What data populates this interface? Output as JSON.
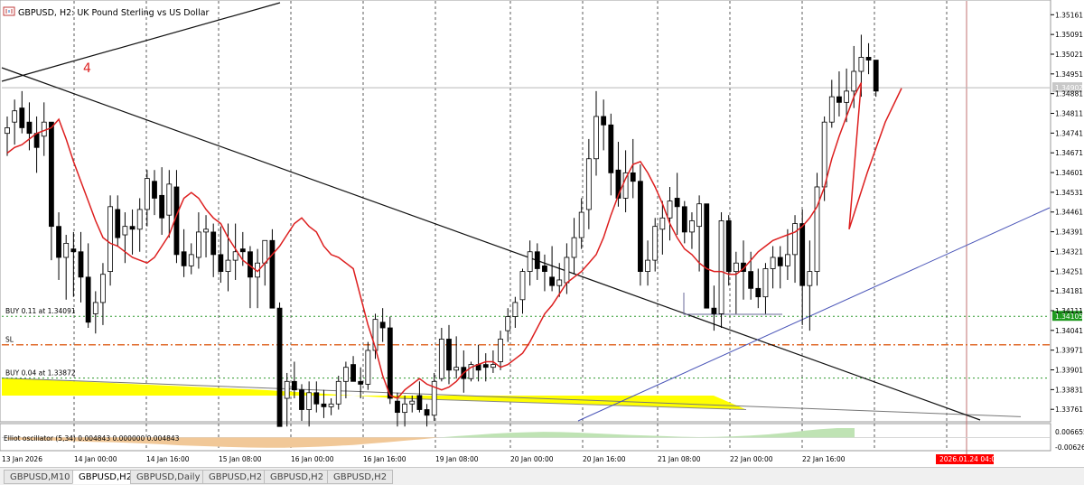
{
  "chart_data": {
    "type": "candlestick",
    "symbol_title": "GBPUSD, H2:  UK Pound Sterling vs US Dollar",
    "price_axis_labels": [
      "1.35161",
      "1.35091",
      "1.35021",
      "1.34951",
      "1.34881",
      "1.34811",
      "1.34741",
      "1.34671",
      "1.34601",
      "1.34531",
      "1.34461",
      "1.34391",
      "1.34321",
      "1.34251",
      "1.34181",
      "1.34111",
      "1.34041",
      "1.33971",
      "1.33901",
      "1.33831",
      "1.33761"
    ],
    "current_price_label": "1.34902",
    "time_axis_labels": [
      "13 Jan 2026",
      "14 Jan 00:00",
      "14 Jan 16:00",
      "15 Jan 08:00",
      "16 Jan 00:00",
      "16 Jan 16:00",
      "19 Jan 08:00",
      "20 Jan 00:00",
      "20 Jan 16:00",
      "21 Jan 08:00",
      "22 Jan 00:00",
      "22 Jan 16:00"
    ],
    "future_time_label": "2026.01.24 04:00",
    "ylim": [
      1.3372,
      1.3521
    ],
    "candles_ohlc": [
      [
        1.3474,
        1.348,
        1.3466,
        1.3476
      ],
      [
        1.3478,
        1.3486,
        1.347,
        1.3482
      ],
      [
        1.3483,
        1.3489,
        1.3474,
        1.3476
      ],
      [
        1.3478,
        1.3485,
        1.3468,
        1.3474
      ],
      [
        1.3474,
        1.348,
        1.346,
        1.3469
      ],
      [
        1.3473,
        1.3485,
        1.3466,
        1.3478
      ],
      [
        1.3478,
        1.3478,
        1.3429,
        1.3441
      ],
      [
        1.3441,
        1.3446,
        1.3422,
        1.343
      ],
      [
        1.343,
        1.3438,
        1.3415,
        1.3435
      ],
      [
        1.3433,
        1.3439,
        1.3416,
        1.3432
      ],
      [
        1.3432,
        1.3439,
        1.3414,
        1.3423
      ],
      [
        1.3423,
        1.3435,
        1.3405,
        1.3407
      ],
      [
        1.341,
        1.3418,
        1.3403,
        1.3414
      ],
      [
        1.3414,
        1.3428,
        1.3406,
        1.3424
      ],
      [
        1.3425,
        1.3452,
        1.342,
        1.3448
      ],
      [
        1.3447,
        1.3452,
        1.3434,
        1.3437
      ],
      [
        1.3438,
        1.3446,
        1.3428,
        1.3441
      ],
      [
        1.3441,
        1.3447,
        1.3431,
        1.344
      ],
      [
        1.344,
        1.3451,
        1.3432,
        1.3447
      ],
      [
        1.3447,
        1.3461,
        1.3441,
        1.3458
      ],
      [
        1.3457,
        1.3461,
        1.3445,
        1.3451
      ],
      [
        1.3452,
        1.3462,
        1.3438,
        1.3444
      ],
      [
        1.3445,
        1.3461,
        1.3437,
        1.3456
      ],
      [
        1.3455,
        1.3461,
        1.3428,
        1.3431
      ],
      [
        1.3432,
        1.344,
        1.3423,
        1.3427
      ],
      [
        1.3427,
        1.3435,
        1.3424,
        1.3431
      ],
      [
        1.343,
        1.3446,
        1.3426,
        1.3439
      ],
      [
        1.3439,
        1.3445,
        1.343,
        1.344
      ],
      [
        1.3439,
        1.3442,
        1.3423,
        1.3431
      ],
      [
        1.3431,
        1.3441,
        1.3421,
        1.3425
      ],
      [
        1.3425,
        1.3442,
        1.3418,
        1.3429
      ],
      [
        1.3429,
        1.3442,
        1.3422,
        1.3432
      ],
      [
        1.3433,
        1.3439,
        1.3427,
        1.3432
      ],
      [
        1.3432,
        1.3434,
        1.3412,
        1.3423
      ],
      [
        1.3423,
        1.3433,
        1.3412,
        1.3428
      ],
      [
        1.3428,
        1.3436,
        1.342,
        1.3436
      ],
      [
        1.3436,
        1.344,
        1.3418,
        1.3412
      ],
      [
        1.3412,
        1.3414,
        1.337,
        1.337
      ],
      [
        1.338,
        1.3389,
        1.337,
        1.3386
      ],
      [
        1.3386,
        1.3393,
        1.338,
        1.3383
      ],
      [
        1.3383,
        1.3385,
        1.3372,
        1.3376
      ],
      [
        1.3376,
        1.3386,
        1.337,
        1.3382
      ],
      [
        1.3382,
        1.3386,
        1.3375,
        1.3378
      ],
      [
        1.3378,
        1.3383,
        1.3373,
        1.3377
      ],
      [
        1.3377,
        1.338,
        1.3374,
        1.3378
      ],
      [
        1.3378,
        1.3388,
        1.3376,
        1.3386
      ],
      [
        1.3386,
        1.3393,
        1.338,
        1.3391
      ],
      [
        1.3392,
        1.3395,
        1.3386,
        1.3386
      ],
      [
        1.3386,
        1.3391,
        1.338,
        1.3385
      ],
      [
        1.3385,
        1.34,
        1.3383,
        1.3397
      ],
      [
        1.3397,
        1.341,
        1.3394,
        1.3408
      ],
      [
        1.3407,
        1.3412,
        1.34,
        1.3405
      ],
      [
        1.3405,
        1.3409,
        1.3378,
        1.338
      ],
      [
        1.3379,
        1.3382,
        1.337,
        1.3375
      ],
      [
        1.3375,
        1.3381,
        1.337,
        1.3378
      ],
      [
        1.3378,
        1.3381,
        1.3375,
        1.3379
      ],
      [
        1.3381,
        1.3386,
        1.3375,
        1.3376
      ],
      [
        1.3376,
        1.3378,
        1.337,
        1.3374
      ],
      [
        1.3374,
        1.3389,
        1.3372,
        1.3386
      ],
      [
        1.3387,
        1.3405,
        1.3386,
        1.3401
      ],
      [
        1.3401,
        1.3406,
        1.3385,
        1.339
      ],
      [
        1.339,
        1.3402,
        1.3387,
        1.3391
      ],
      [
        1.3391,
        1.3397,
        1.3382,
        1.3387
      ],
      [
        1.3387,
        1.3393,
        1.3386,
        1.3392
      ],
      [
        1.3392,
        1.3399,
        1.3386,
        1.339
      ],
      [
        1.3392,
        1.3396,
        1.3386,
        1.3391
      ],
      [
        1.3391,
        1.3397,
        1.3389,
        1.3392
      ],
      [
        1.3393,
        1.3404,
        1.339,
        1.3401
      ],
      [
        1.3404,
        1.3412,
        1.34,
        1.3409
      ],
      [
        1.3409,
        1.3416,
        1.3405,
        1.3414
      ],
      [
        1.3415,
        1.3426,
        1.341,
        1.3425
      ],
      [
        1.3425,
        1.3436,
        1.342,
        1.3432
      ],
      [
        1.3432,
        1.3435,
        1.3422,
        1.3426
      ],
      [
        1.3427,
        1.3431,
        1.3418,
        1.3425
      ],
      [
        1.3423,
        1.3434,
        1.3418,
        1.342
      ],
      [
        1.342,
        1.3428,
        1.3416,
        1.3422
      ],
      [
        1.3421,
        1.3435,
        1.3417,
        1.343
      ],
      [
        1.343,
        1.3444,
        1.3424,
        1.3437
      ],
      [
        1.3437,
        1.3451,
        1.3433,
        1.3446
      ],
      [
        1.3447,
        1.3472,
        1.344,
        1.3465
      ],
      [
        1.3465,
        1.3489,
        1.3459,
        1.348
      ],
      [
        1.348,
        1.3486,
        1.3468,
        1.3477
      ],
      [
        1.3477,
        1.3481,
        1.3452,
        1.346
      ],
      [
        1.3461,
        1.3471,
        1.3448,
        1.3451
      ],
      [
        1.3451,
        1.3468,
        1.3446,
        1.346
      ],
      [
        1.346,
        1.3472,
        1.3451,
        1.3457
      ],
      [
        1.3457,
        1.3463,
        1.342,
        1.3425
      ],
      [
        1.3425,
        1.3436,
        1.342,
        1.3429
      ],
      [
        1.3429,
        1.3444,
        1.3425,
        1.3441
      ],
      [
        1.344,
        1.345,
        1.3431,
        1.3444
      ],
      [
        1.3444,
        1.3455,
        1.3436,
        1.345
      ],
      [
        1.3451,
        1.346,
        1.3438,
        1.3448
      ],
      [
        1.3448,
        1.345,
        1.3435,
        1.3439
      ],
      [
        1.3439,
        1.3446,
        1.3433,
        1.3443
      ],
      [
        1.3441,
        1.3452,
        1.3425,
        1.3449
      ],
      [
        1.3449,
        1.3446,
        1.3412,
        1.3412
      ],
      [
        1.3412,
        1.342,
        1.3404,
        1.341
      ],
      [
        1.341,
        1.3446,
        1.3405,
        1.3443
      ],
      [
        1.3443,
        1.3445,
        1.342,
        1.3425
      ],
      [
        1.3425,
        1.3432,
        1.341,
        1.3428
      ],
      [
        1.3428,
        1.3436,
        1.3415,
        1.3425
      ],
      [
        1.3425,
        1.3432,
        1.3415,
        1.3419
      ],
      [
        1.3419,
        1.3426,
        1.3412,
        1.3416
      ],
      [
        1.3416,
        1.3428,
        1.341,
        1.3426
      ],
      [
        1.3426,
        1.3434,
        1.3419,
        1.343
      ],
      [
        1.343,
        1.3434,
        1.3419,
        1.3427
      ],
      [
        1.3427,
        1.344,
        1.3422,
        1.3431
      ],
      [
        1.3431,
        1.3445,
        1.3421,
        1.3442
      ],
      [
        1.3442,
        1.3447,
        1.3406,
        1.342
      ],
      [
        1.342,
        1.3436,
        1.3404,
        1.3425
      ],
      [
        1.3425,
        1.346,
        1.342,
        1.3455
      ],
      [
        1.3455,
        1.348,
        1.345,
        1.3478
      ],
      [
        1.3478,
        1.3493,
        1.3476,
        1.3487
      ],
      [
        1.3487,
        1.3496,
        1.348,
        1.3485
      ],
      [
        1.3485,
        1.3497,
        1.3478,
        1.3489
      ],
      [
        1.3489,
        1.3505,
        1.3483,
        1.3496
      ],
      [
        1.3496,
        1.3509,
        1.3487,
        1.3501
      ],
      [
        1.3501,
        1.3506,
        1.3495,
        1.35
      ],
      [
        1.35,
        1.35,
        1.3487,
        1.3489
      ]
    ],
    "moving_average": {
      "color": "#dd1f1f",
      "values": [
        1.3467,
        1.3469,
        1.347,
        1.3472,
        1.3474,
        1.3475,
        1.3476,
        1.3479,
        1.3472,
        1.3464,
        1.3457,
        1.345,
        1.3443,
        1.3437,
        1.3435,
        1.3434,
        1.3432,
        1.343,
        1.3429,
        1.3428,
        1.343,
        1.3434,
        1.3438,
        1.3445,
        1.3451,
        1.3453,
        1.3451,
        1.3447,
        1.3444,
        1.3442,
        1.3437,
        1.3433,
        1.3429,
        1.3427,
        1.3425,
        1.3428,
        1.3431,
        1.3434,
        1.3438,
        1.3442,
        1.3444,
        1.3441,
        1.3439,
        1.3434,
        1.3431,
        1.343,
        1.3428,
        1.3426,
        1.3416,
        1.3406,
        1.3398,
        1.3388,
        1.3381,
        1.338,
        1.3383,
        1.3385,
        1.3387,
        1.3385,
        1.3384,
        1.3383,
        1.3384,
        1.3386,
        1.3389,
        1.3391,
        1.3392,
        1.3393,
        1.3393,
        1.3391,
        1.3392,
        1.3394,
        1.3396,
        1.34,
        1.3405,
        1.341,
        1.3413,
        1.3417,
        1.3421,
        1.3423,
        1.3425,
        1.3428,
        1.3431,
        1.3437,
        1.3445,
        1.3452,
        1.3458,
        1.3463,
        1.3464,
        1.346,
        1.3455,
        1.3449,
        1.3442,
        1.3437,
        1.3433,
        1.3431,
        1.3428,
        1.3426,
        1.3425,
        1.3425,
        1.3424,
        1.3424,
        1.3426,
        1.3429,
        1.3432,
        1.3434,
        1.3436,
        1.3437,
        1.3438,
        1.3439,
        1.3441,
        1.3444,
        1.3448,
        1.3455,
        1.3465,
        1.3473,
        1.348,
        1.3487,
        1.3492
      ]
    },
    "order_levels": [
      {
        "label": "BUY 0.11 at 1.34091",
        "price": 1.34091,
        "color": "#2e9a2e",
        "tag": "1.34105",
        "tag_color": "#1f9a1f"
      },
      {
        "label": "SL",
        "price": 1.3399,
        "color": "#e06a2a"
      },
      {
        "label": "BUY 0.04 at 1.33872",
        "price": 1.33872,
        "color": "#2e9a2e"
      }
    ],
    "trend_annotation": "4",
    "oscillator": {
      "title": "Elliot oscillator (5,34) 0.004843 0.000000 0.004843",
      "axis_top": "0.006655",
      "axis_bottom": "-0.006269",
      "ylim": [
        -0.006269,
        0.006655
      ],
      "values": [
        -0.001,
        -0.0012,
        -0.0014,
        -0.0016,
        -0.0019,
        -0.0022,
        -0.0024,
        -0.0027,
        -0.0031,
        -0.0035,
        -0.004,
        -0.0043,
        -0.0046,
        -0.0049,
        -0.0051,
        -0.0052,
        -0.0052,
        -0.005,
        -0.0047,
        -0.0043,
        -0.0038,
        -0.0031,
        -0.0024,
        -0.0016,
        -0.0008,
        0.0,
        0.0007,
        0.0013,
        0.0019,
        0.0024,
        0.0027,
        0.0029,
        0.0028,
        0.0025,
        0.0021,
        0.0017,
        0.0013,
        0.001,
        0.0007,
        0.0004,
        0.0002,
        0.0003,
        0.0006,
        0.001,
        0.0016,
        0.0024,
        0.0034,
        0.0042,
        0.0048,
        0.0048
      ],
      "positive_color": "#bfe3b4",
      "negative_color": "#f1c898"
    }
  },
  "tabs": [
    {
      "label": "GBPUSD,M10",
      "active": false
    },
    {
      "label": "GBPUSD,H2",
      "active": true
    },
    {
      "label": "GBPUSD,Daily",
      "active": false
    },
    {
      "label": "GBPUSD,H2",
      "active": false
    },
    {
      "label": "GBPUSD,H2",
      "active": false
    },
    {
      "label": "GBPUSD,H2",
      "active": false
    }
  ],
  "colors": {
    "bull_body": "#ffffff",
    "bear_body": "#000000",
    "wick": "#000000",
    "yellow_zone": "#ffff00",
    "blue_trend": "#4a55b8",
    "black_trend": "#111111",
    "future_line": "#c07070",
    "future_tag_bg": "#ff0000"
  }
}
